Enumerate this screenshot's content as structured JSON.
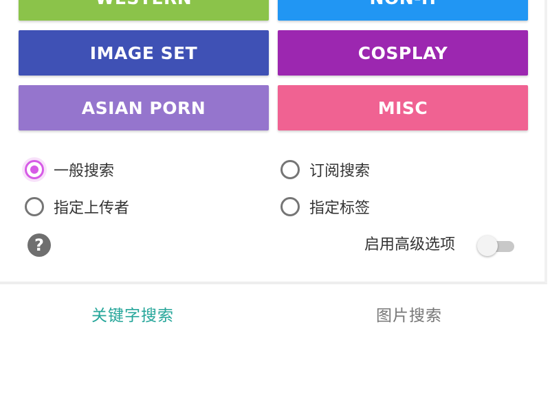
{
  "categories": [
    {
      "label": "WESTERN",
      "color": "#8bc34a"
    },
    {
      "label": "NON-H",
      "color": "#2196f3"
    },
    {
      "label": "IMAGE SET",
      "color": "#3f51b5"
    },
    {
      "label": "COSPLAY",
      "color": "#9c27b0"
    },
    {
      "label": "ASIAN PORN",
      "color": "#9575cd"
    },
    {
      "label": "MISC",
      "color": "#f06292"
    }
  ],
  "search_modes": [
    {
      "label": "一般搜索",
      "checked": true
    },
    {
      "label": "订阅搜索",
      "checked": false
    },
    {
      "label": "指定上传者",
      "checked": false
    },
    {
      "label": "指定标签",
      "checked": false
    }
  ],
  "help": {
    "icon": "help-icon",
    "glyph": "?"
  },
  "advanced": {
    "label": "启用高级选项",
    "enabled": false
  },
  "tabs": [
    {
      "label": "关键字搜索",
      "active": true,
      "color": "#26a69a"
    },
    {
      "label": "图片搜索",
      "active": false,
      "color": "#777777"
    }
  ]
}
